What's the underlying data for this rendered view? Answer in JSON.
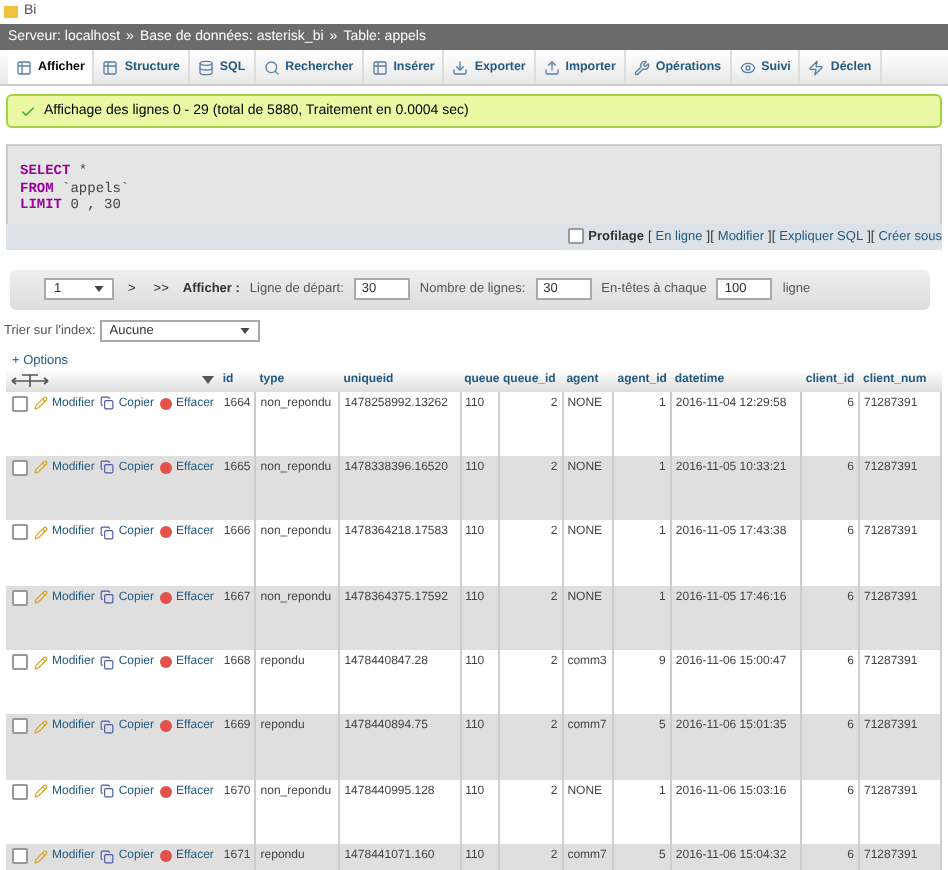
{
  "window": {
    "title": "Bi"
  },
  "breadcrumb": [
    {
      "label": "Serveur: localhost"
    },
    {
      "separator": "»",
      "label": "Base de données: asterisk_bi"
    },
    {
      "separator": "»",
      "label": "Table: appels"
    }
  ],
  "tabs": [
    {
      "label": "Afficher",
      "selected": true
    },
    {
      "label": "Structure",
      "selected": false
    },
    {
      "label": "SQL",
      "selected": false
    },
    {
      "label": "Rechercher",
      "selected": false
    },
    {
      "label": "Insérer",
      "selected": false
    },
    {
      "label": "Exporter",
      "selected": false
    },
    {
      "label": "Importer",
      "selected": false
    },
    {
      "label": "Opérations",
      "selected": false
    },
    {
      "label": "Suivi",
      "selected": false
    },
    {
      "label": "Déclen",
      "selected": false
    }
  ],
  "message": "Affichage des lignes 0 - 29 (total de 5880, Traitement en 0.0004 sec)",
  "sql": [
    {
      "keyword": "SELECT",
      "rest": "*"
    },
    {
      "keyword": "FROM",
      "rest": "`appels`"
    },
    {
      "keyword": "LIMIT",
      "rest": "0 , 30"
    }
  ],
  "profiling": {
    "label": "Profilage",
    "checked": false,
    "links": [
      {
        "bracket": "[",
        "label": "En ligne"
      },
      {
        "bracket": "][",
        "label": "Modifier"
      },
      {
        "bracket": "][",
        "label": "Expliquer SQL"
      },
      {
        "bracket": "][",
        "label": "Créer sous"
      }
    ]
  },
  "pager": {
    "page": "1",
    "next": ">",
    "last": ">>",
    "show_label": "Afficher :",
    "start_label": "Ligne de départ:",
    "start": "30",
    "count_label": "Nombre de lignes:",
    "count": "30",
    "headers_label": "En-têtes à chaque",
    "headers": "100",
    "headers_unit": "ligne"
  },
  "sort": {
    "label": "Trier sur l'index:",
    "value": "Aucune"
  },
  "options": "+ Options",
  "columns": [
    "id",
    "type",
    "uniqueid",
    "queue",
    "queue_id",
    "agent",
    "agent_id",
    "datetime",
    "client_id",
    "client_num"
  ],
  "rows": [
    {
      "checked": false,
      "actions": [
        "Modifier",
        "Copier",
        "Effacer"
      ],
      "cells": [
        "1664",
        "non_repondu",
        "1478258992.13262",
        "110",
        "2",
        "NONE",
        "1",
        "2016-11-04 12:29:58",
        "6",
        "71287391"
      ]
    },
    {
      "checked": false,
      "actions": [
        "Modifier",
        "Copier",
        "Effacer"
      ],
      "cells": [
        "1665",
        "non_repondu",
        "1478338396.16520",
        "110",
        "2",
        "NONE",
        "1",
        "2016-11-05 10:33:21",
        "6",
        "71287391"
      ]
    },
    {
      "checked": false,
      "actions": [
        "Modifier",
        "Copier",
        "Effacer"
      ],
      "cells": [
        "1666",
        "non_repondu",
        "1478364218.17583",
        "110",
        "2",
        "NONE",
        "1",
        "2016-11-05 17:43:38",
        "6",
        "71287391"
      ]
    },
    {
      "checked": false,
      "actions": [
        "Modifier",
        "Copier",
        "Effacer"
      ],
      "cells": [
        "1667",
        "non_repondu",
        "1478364375.17592",
        "110",
        "2",
        "NONE",
        "1",
        "2016-11-05 17:46:16",
        "6",
        "71287391"
      ]
    },
    {
      "checked": false,
      "actions": [
        "Modifier",
        "Copier",
        "Effacer"
      ],
      "cells": [
        "1668",
        "repondu",
        "1478440847.28",
        "110",
        "2",
        "comm3",
        "9",
        "2016-11-06 15:00:47",
        "6",
        "71287391"
      ]
    },
    {
      "checked": false,
      "actions": [
        "Modifier",
        "Copier",
        "Effacer"
      ],
      "cells": [
        "1669",
        "repondu",
        "1478440894.75",
        "110",
        "2",
        "comm7",
        "5",
        "2016-11-06 15:01:35",
        "6",
        "71287391"
      ]
    },
    {
      "checked": false,
      "actions": [
        "Modifier",
        "Copier",
        "Effacer"
      ],
      "cells": [
        "1670",
        "non_repondu",
        "1478440995.128",
        "110",
        "2",
        "NONE",
        "1",
        "2016-11-06 15:03:16",
        "6",
        "71287391"
      ]
    },
    {
      "checked": false,
      "actions": [
        "Modifier",
        "Copier",
        "Effacer"
      ],
      "cells": [
        "1671",
        "repondu",
        "1478441071.160",
        "110",
        "2",
        "comm7",
        "5",
        "2016-11-06 15:04:32",
        "6",
        "71287391"
      ]
    }
  ]
}
